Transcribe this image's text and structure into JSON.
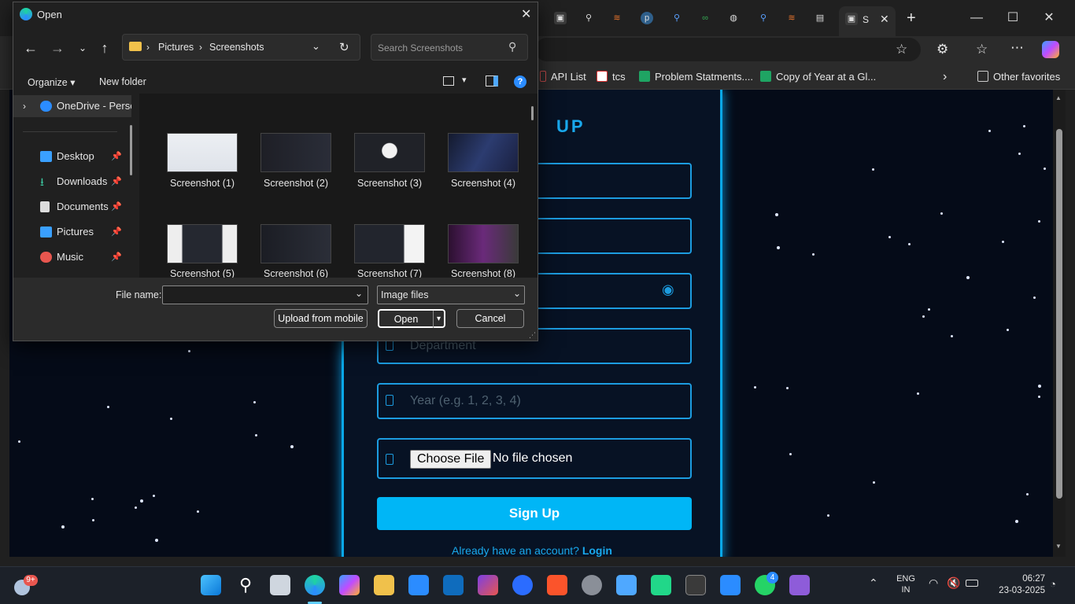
{
  "dialog": {
    "title": "Open",
    "breadcrumb": [
      "Pictures",
      "Screenshots"
    ],
    "search_placeholder": "Search Screenshots",
    "organize_label": "Organize",
    "new_folder_label": "New folder",
    "sidebar": [
      {
        "label": "OneDrive - Perso",
        "icon": "cloud-icon",
        "pinned": false
      },
      {
        "label": "Desktop",
        "icon": "desktop-icon",
        "pinned": true
      },
      {
        "label": "Downloads",
        "icon": "download-icon",
        "pinned": true
      },
      {
        "label": "Documents",
        "icon": "documents-icon",
        "pinned": true
      },
      {
        "label": "Pictures",
        "icon": "pictures-icon",
        "pinned": true
      },
      {
        "label": "Music",
        "icon": "music-icon",
        "pinned": true
      }
    ],
    "files": [
      {
        "name": "Screenshot (1)"
      },
      {
        "name": "Screenshot (2)"
      },
      {
        "name": "Screenshot (3)"
      },
      {
        "name": "Screenshot (4)"
      },
      {
        "name": "Screenshot (5)"
      },
      {
        "name": "Screenshot (6)"
      },
      {
        "name": "Screenshot (7)"
      },
      {
        "name": "Screenshot (8)"
      }
    ],
    "filename_label": "File name:",
    "filename_value": "",
    "filetype_value": "Image files",
    "upload_label": "Upload from mobile",
    "open_label": "Open",
    "cancel_label": "Cancel"
  },
  "browser": {
    "favorites": [
      {
        "label": "API List",
        "icon": "page-icon"
      },
      {
        "label": "tcs",
        "icon": "tcs-icon"
      },
      {
        "label": "Problem Statments....",
        "icon": "sheets-icon"
      },
      {
        "label": "Copy of Year at a Gl...",
        "icon": "sheets-icon"
      }
    ],
    "other_favorites": "Other favorites",
    "active_tab_label": "S"
  },
  "page": {
    "heading": "UP",
    "fields": [
      {
        "placeholder": "",
        "icon": "user-icon"
      },
      {
        "placeholder": "",
        "icon": "mail-icon"
      },
      {
        "placeholder": "",
        "icon": "lock-icon"
      },
      {
        "placeholder": "Department",
        "icon": "building-icon"
      },
      {
        "placeholder": "Year (e.g. 1, 2, 3, 4)",
        "icon": "calendar-icon"
      }
    ],
    "file_button": "Choose File",
    "file_status": "No file chosen",
    "submit": "Sign Up",
    "login_prompt": "Already have an account?",
    "login_link": "Login"
  },
  "taskbar": {
    "weather_badge": "9+",
    "whatsapp_badge": "4",
    "lang_line1": "ENG",
    "lang_line2": "IN",
    "time": "06:27",
    "date": "23-03-2025"
  },
  "colors": {
    "accent": "#00b6f6",
    "panel_border": "#0aa8e8",
    "page_bg": "#050b18"
  }
}
